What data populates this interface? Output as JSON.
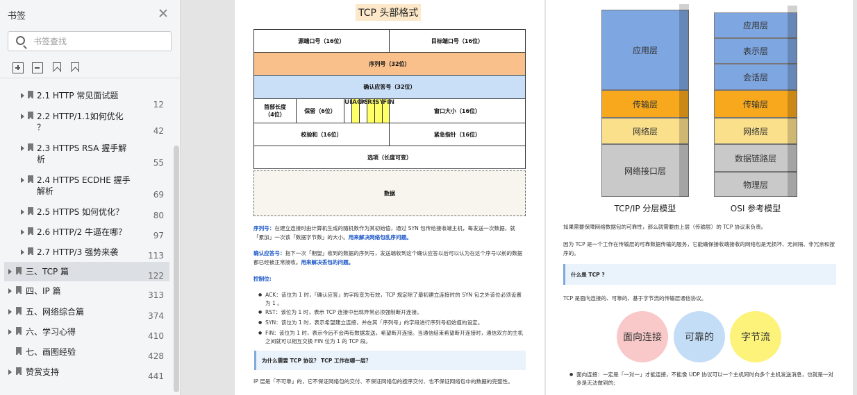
{
  "sidebar": {
    "title": "书签",
    "search_placeholder": "书签查找",
    "items": [
      {
        "label": "2.1 HTTP 常见面试题",
        "page": "12"
      },
      {
        "label": "2.2 HTTP/1.1如何优化\n？",
        "page": "42"
      },
      {
        "label": "2.3 HTTPS RSA 握手解\n析",
        "page": "55"
      },
      {
        "label": "2.4 HTTPS ECDHE 握手\n解析",
        "page": "69"
      },
      {
        "label": "2.5 HTTPS 如何优化？",
        "page": "80"
      },
      {
        "label": "2.6 HTTP/2 牛逼在哪？",
        "page": "97"
      },
      {
        "label": "2.7 HTTP/3 强势来袭",
        "page": "113"
      },
      {
        "label": "三、TCP 篇",
        "page": "122"
      },
      {
        "label": "四、IP 篇",
        "page": "313"
      },
      {
        "label": "五、网络综合篇",
        "page": "374"
      },
      {
        "label": "六、学习心得",
        "page": "410"
      },
      {
        "label": "七、画图经验",
        "page": "428"
      },
      {
        "label": "赞赏支持",
        "page": "441"
      }
    ]
  },
  "left_page": {
    "title": "TCP 头部格式",
    "header": {
      "src_port": "源端口号（16位）",
      "dst_port": "目标端口号（16位）",
      "seq": "序列号（32位）",
      "ack": "确认应答号（32位）",
      "hdr_len": "首部长度\n（4位）",
      "reserved": "保留（6位）",
      "flags": [
        "URG",
        "ACK",
        "PSH",
        "RST",
        "SYN",
        "FIN"
      ],
      "window": "窗口大小（16位）",
      "checksum": "校验和（16位）",
      "urgent": "紧急指针（16位）",
      "options": "选项（长度可变）",
      "data": "数据"
    },
    "p1_label": "序列号：",
    "p1_text": "在建立连接时由计算机生成的随机数作为其初始值，通过 SYN 包传给接收端主机，每发送一次数据，就「累加」一次该「数据字节数」的大小。",
    "p1_link": "用来解决网络包乱序问题。",
    "p2_label": "确认应答号：",
    "p2_text": "指下一次「期望」收到的数据的序列号，发送端收到这个确认应答以后可以认为在这个序号以前的数据都已经被正常接收。",
    "p2_link": "用来解决丢包的问题。",
    "ctrl_label": "控制位:",
    "b1": "ACK：该位为 1 时，「确认应答」的字段变为有效，TCP 规定除了最初建立连接时的 SYN 包之外该位必须设置为 1 。",
    "b2": "RST：该位为 1 时，表示 TCP 连接中出现异常必须强制断开连接。",
    "b3": "SYN：该位为 1 时，表示希望建立连接，并在其「序列号」的字段进行序列号初始值的设定。",
    "b4": "FIN：该位为 1 时，表示今后不会再有数据发送，希望断开连接。当通信结束希望断开连接时，通信双方的主机之间就可以相互交换 FIN 位为 1 的 TCP 段。",
    "quote": "为什么需要 TCP 协议？ TCP 工作在哪一层？",
    "ip_text": "IP 层是「不可靠」的，它不保证网络包的交付、不保证网络包的按序交付、也不保证网络包中的数据的完整性。"
  },
  "right_page": {
    "tcpip_layers": [
      "应用层",
      "传输层",
      "网络层",
      "网络接口层"
    ],
    "osi_layers": [
      "应用层",
      "表示层",
      "会话层",
      "传输层",
      "网络层",
      "数据链路层",
      "物理层"
    ],
    "tcpip_caption": "TCP/IP 分层模型",
    "osi_caption": "OSI 参考模型",
    "p1": "如果需要保障网络数据包的可靠性，那么就需要由上层（传输层）的 TCP 协议来负责。",
    "p2": "因为 TCP 是一个工作在传输层的可靠数据传输的服务，它能确保接收端接收的网络包是无损坏、无间隔、非冗余和按序的。",
    "quote": "什么是 TCP ?",
    "p3": "TCP 是面向连接的、可靠的、基于字节流的传输层通信协议。",
    "bubbles": [
      "面向连接",
      "可靠的",
      "字节流"
    ],
    "b1": "面向连接：一定是「一对一」才能连接，不能像 UDP 协议可以一个主机同时向多个主机发送消息，也就是一对多是无法做到的;"
  },
  "colors": {
    "seq_fill": "#f9c08c",
    "ack_fill": "#c9def7",
    "flag_fill": "#ffff66",
    "app_layer": "#7ea6e0",
    "transport_layer": "#f7a81d",
    "network_layer": "#fbe08c",
    "link_layer": "#c9c9c9",
    "bubble1": "#f9c9c9",
    "bubble2": "#c4ddf7",
    "bubble3": "#fdf37a"
  }
}
